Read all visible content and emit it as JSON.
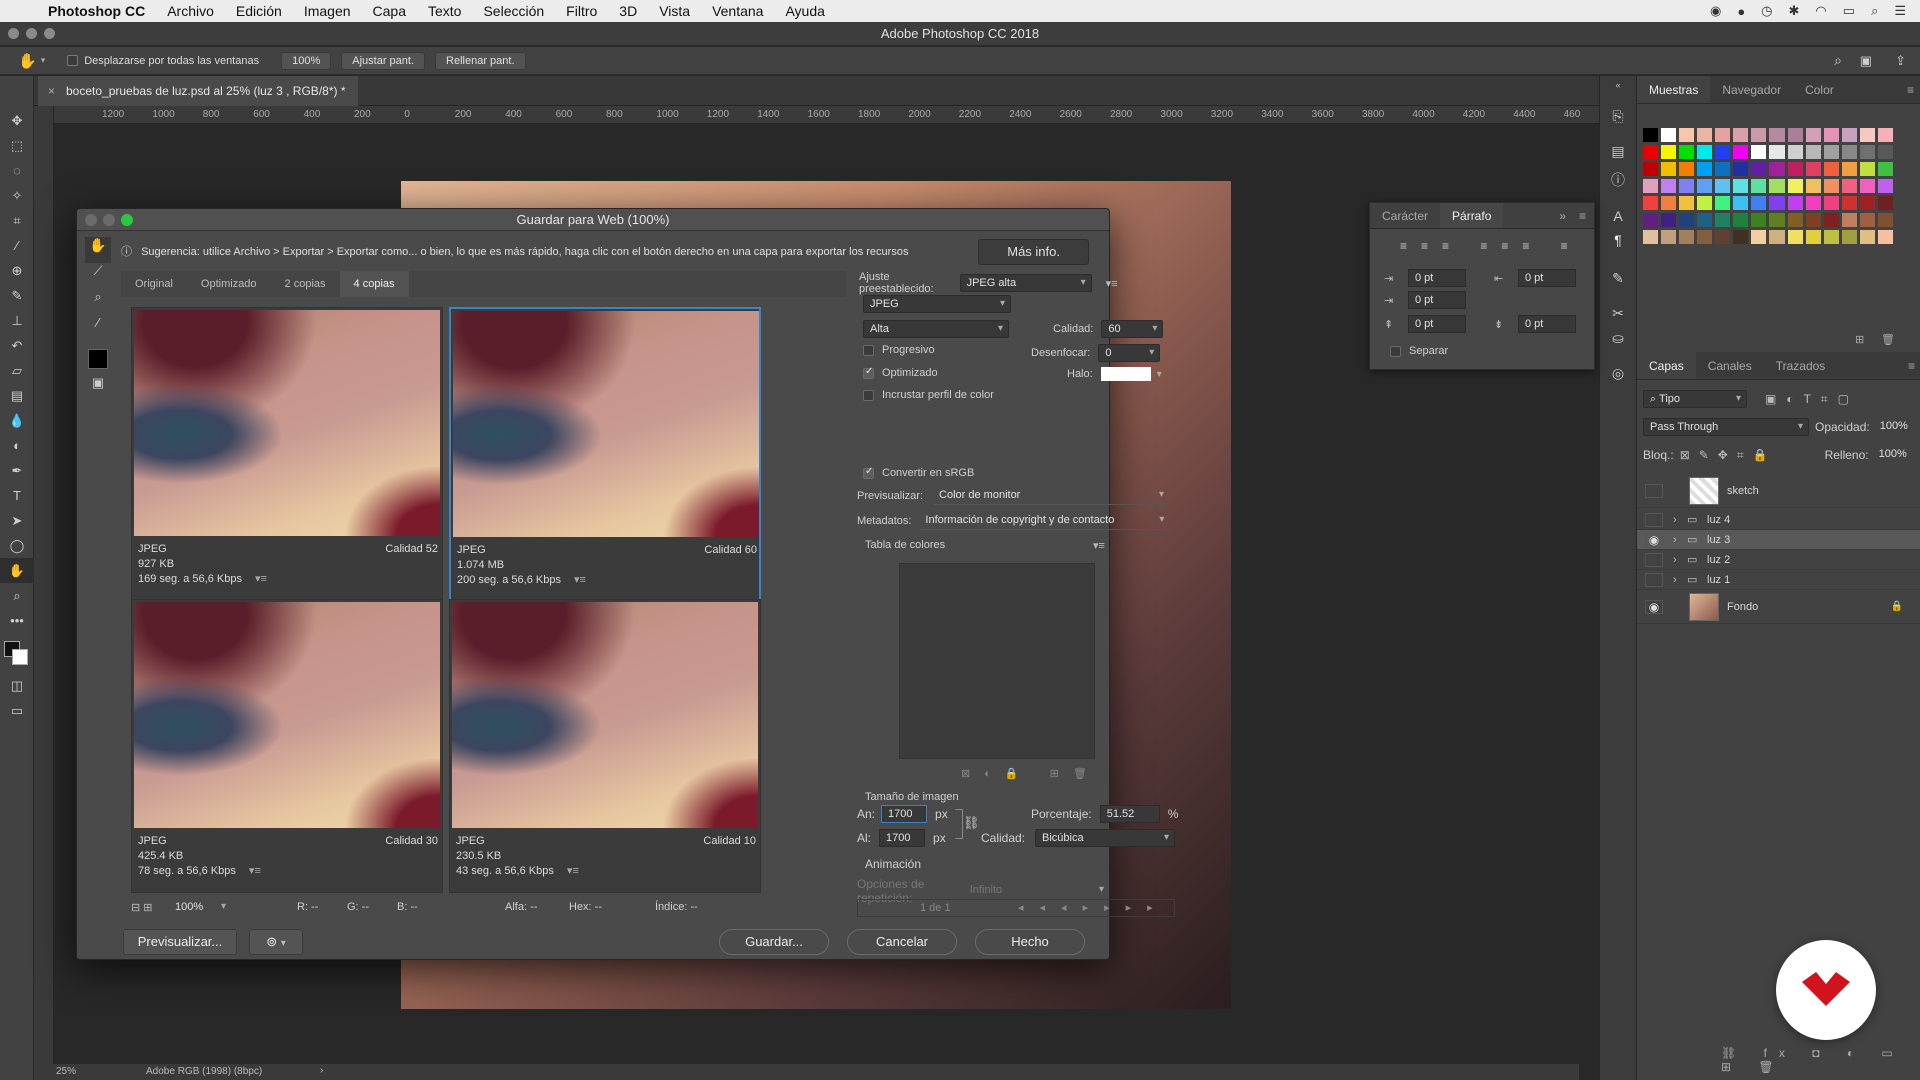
{
  "menubar": {
    "app": "Photoshop CC",
    "items": [
      "Archivo",
      "Edición",
      "Imagen",
      "Capa",
      "Texto",
      "Selección",
      "Filtro",
      "3D",
      "Vista",
      "Ventana",
      "Ayuda"
    ]
  },
  "window": {
    "title": "Adobe Photoshop CC 2018"
  },
  "options_bar": {
    "scroll_all_label": "Desplazarse por todas las ventanas",
    "zoom": "100%",
    "fit_label": "Ajustar pant.",
    "fill_label": "Rellenar pant."
  },
  "document": {
    "tab_title": "boceto_pruebas de luz.psd al 25% (luz 3 , RGB/8*) *",
    "ruler_ticks": [
      "1200",
      "1000",
      "800",
      "600",
      "400",
      "200",
      "0",
      "200",
      "400",
      "600",
      "800",
      "1000",
      "1200",
      "1400",
      "1600",
      "1800",
      "2000",
      "2200",
      "2400",
      "2600",
      "2800",
      "3000",
      "3200",
      "3400",
      "3600",
      "3800",
      "4000",
      "4200",
      "4400",
      "460"
    ],
    "zoom_status": "25%",
    "color_profile": "Adobe RGB (1998) (8bpc)"
  },
  "dialog": {
    "title": "Guardar para Web (100%)",
    "hint": "Sugerencia: utilice Archivo > Exportar > Exportar como... o bien, lo que es más rápido, haga clic con el botón derecho en una capa para exportar los recursos",
    "more_info": "Más info.",
    "tabs": [
      "Original",
      "Optimizado",
      "2 copias",
      "4 copias"
    ],
    "panes": [
      {
        "format": "JPEG",
        "quality": "Calidad 52",
        "size": "927 KB",
        "time": "169 seg. a 56,6 Kbps"
      },
      {
        "format": "JPEG",
        "quality": "Calidad 60",
        "size": "1.074 MB",
        "time": "200 seg. a 56,6 Kbps"
      },
      {
        "format": "JPEG",
        "quality": "Calidad 30",
        "size": "425.4 KB",
        "time": "78 seg. a 56,6 Kbps"
      },
      {
        "format": "JPEG",
        "quality": "Calidad 10",
        "size": "230.5 KB",
        "time": "43 seg. a 56,6 Kbps"
      }
    ],
    "settings": {
      "preset_label": "Ajuste preestablecido:",
      "preset_value": "JPEG alta",
      "format": "JPEG",
      "quality_level": "Alta",
      "quality_label": "Calidad:",
      "quality_value": "60",
      "progressive": "Progresivo",
      "blur_label": "Desenfocar:",
      "blur_value": "0",
      "optimized": "Optimizado",
      "halo_label": "Halo:",
      "embed_profile": "Incrustar perfil de color",
      "convert_srgb": "Convertir en sRGB",
      "preview_label": "Previsualizar:",
      "preview_value": "Color de monitor",
      "metadata_label": "Metadatos:",
      "metadata_value": "Información de copyright y de contacto",
      "color_table": "Tabla de colores",
      "image_size": "Tamaño de imagen",
      "width_label": "An:",
      "width_value": "1700",
      "height_label": "Al:",
      "height_value": "1700",
      "unit": "px",
      "percent_label": "Porcentaje:",
      "percent_value": "51.52",
      "percent_unit": "%",
      "resample_label": "Calidad:",
      "resample_value": "Bicúbica",
      "animation": "Animación",
      "loop_label": "Opciones de repetición:",
      "loop_value": "Infinito",
      "frame": "1 de 1"
    },
    "bottom": {
      "zoom": "100%",
      "r": "R: --",
      "g": "G: --",
      "b": "B: --",
      "alpha": "Alfa: --",
      "hex": "Hex: --",
      "index": "Índice: --"
    },
    "buttons": {
      "preview": "Previsualizar...",
      "save": "Guardar...",
      "cancel": "Cancelar",
      "done": "Hecho"
    }
  },
  "char_panel": {
    "tabs": [
      "Carácter",
      "Párrafo"
    ],
    "fields": [
      "0 pt",
      "0 pt",
      "0 pt",
      "0 pt",
      "0 pt"
    ],
    "hyphen": "Separar"
  },
  "swatches_panel": {
    "tabs": [
      "Muestras",
      "Navegador",
      "Color"
    ]
  },
  "layers_panel": {
    "tabs": [
      "Capas",
      "Canales",
      "Trazados"
    ],
    "filter": "Tipo",
    "blend_mode": "Pass Through",
    "opacity_label": "Opacidad:",
    "opacity_value": "100%",
    "lock_label": "Bloq.:",
    "fill_label": "Relleno:",
    "fill_value": "100%",
    "layers": [
      {
        "name": "sketch",
        "visible": false,
        "group": false
      },
      {
        "name": "luz 4",
        "visible": false,
        "group": true
      },
      {
        "name": "luz 3",
        "visible": true,
        "group": true,
        "selected": true
      },
      {
        "name": "luz 2",
        "visible": false,
        "group": true
      },
      {
        "name": "luz 1",
        "visible": false,
        "group": true
      },
      {
        "name": "Fondo",
        "visible": true,
        "group": false
      }
    ]
  },
  "colors": {
    "accent_blue": "#3b82c7",
    "logo_red": "#d0131c"
  }
}
